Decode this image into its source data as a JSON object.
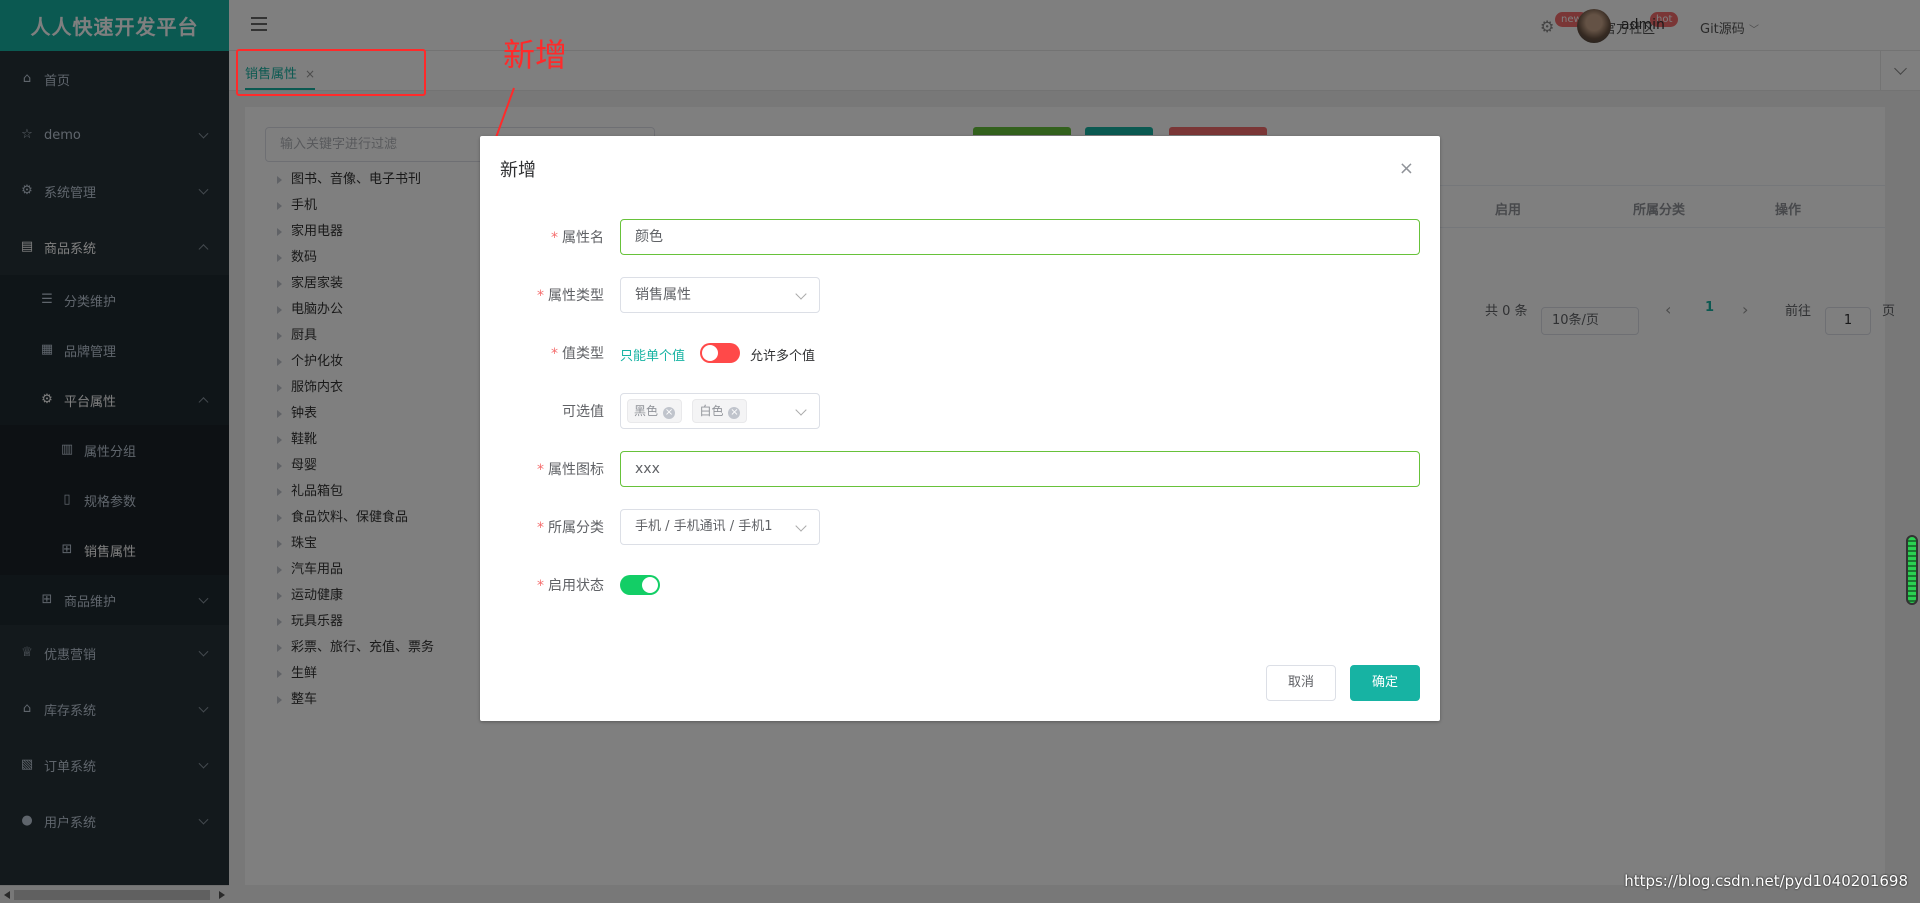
{
  "app": {
    "title": "人人快速开发平台"
  },
  "sidebar": {
    "items": [
      {
        "label": "首页",
        "icon": "home-icon"
      },
      {
        "label": "demo",
        "icon": "star-icon"
      },
      {
        "label": "系统管理",
        "icon": "gear-icon"
      },
      {
        "label": "商品系统",
        "icon": "goods-icon"
      },
      {
        "label": "分类维护",
        "icon": "list-icon"
      },
      {
        "label": "品牌管理",
        "icon": "brand-icon"
      },
      {
        "label": "平台属性",
        "icon": "gear-icon"
      },
      {
        "label": "属性分组",
        "icon": "bar-chart-icon"
      },
      {
        "label": "规格参数",
        "icon": "document-icon"
      },
      {
        "label": "销售属性",
        "icon": "grid-icon"
      },
      {
        "label": "商品维护",
        "icon": "grid-icon"
      },
      {
        "label": "优惠营销",
        "icon": "trophy-icon"
      },
      {
        "label": "库存系统",
        "icon": "home-icon"
      },
      {
        "label": "订单系统",
        "icon": "order-icon"
      },
      {
        "label": "用户系统",
        "icon": "user-icon"
      }
    ]
  },
  "topbar": {
    "badge_new": "new",
    "community": "官方社区",
    "badge_hot": "hot",
    "git": "Git源码",
    "user": "admin"
  },
  "tabs": [
    {
      "label": "销售属性",
      "close": "×"
    }
  ],
  "content": {
    "filter_placeholder": "输入关键字进行过滤",
    "tree": [
      "图书、音像、电子书刊",
      "手机",
      "家用电器",
      "数码",
      "家居家装",
      "电脑办公",
      "厨具",
      "个护化妆",
      "服饰内衣",
      "钟表",
      "鞋靴",
      "母婴",
      "礼品箱包",
      "食品饮料、保健食品",
      "珠宝",
      "汽车用品",
      "运动健康",
      "玩具乐器",
      "彩票、旅行、充值、票务",
      "生鲜",
      "整车"
    ],
    "table_headers": [
      "启用",
      "所属分类",
      "操作"
    ],
    "pager": {
      "total": "共 0 条",
      "page_size": "10条/页",
      "current": "1",
      "goto": "前往",
      "goto_value": "1",
      "page_unit": "页",
      "prev": "‹",
      "next": "›"
    }
  },
  "modal": {
    "title": "新增",
    "close": "×",
    "fields": {
      "attr_name": {
        "label": "属性名",
        "value": "颜色"
      },
      "attr_type": {
        "label": "属性类型",
        "value": "销售属性"
      },
      "value_type": {
        "label": "值类型",
        "left": "只能单个值",
        "right": "允许多个值"
      },
      "options": {
        "label": "可选值",
        "tags": [
          "黑色",
          "白色"
        ]
      },
      "attr_icon": {
        "label": "属性图标",
        "value": "xxx"
      },
      "category": {
        "label": "所属分类",
        "value": "手机 / 手机通讯 / 手机1"
      },
      "enable": {
        "label": "启用状态"
      }
    },
    "cancel": "取消",
    "confirm": "确定"
  },
  "annotation": {
    "text": "新增"
  },
  "watermark": "https://blog.csdn.net/pyd1040201698",
  "colors": {
    "accent": "#17b3a3",
    "sidebar": "#263238",
    "annotation": "#ff2a2a",
    "switch_off_red": "#ff4949",
    "switch_on_green": "#13ce66"
  }
}
